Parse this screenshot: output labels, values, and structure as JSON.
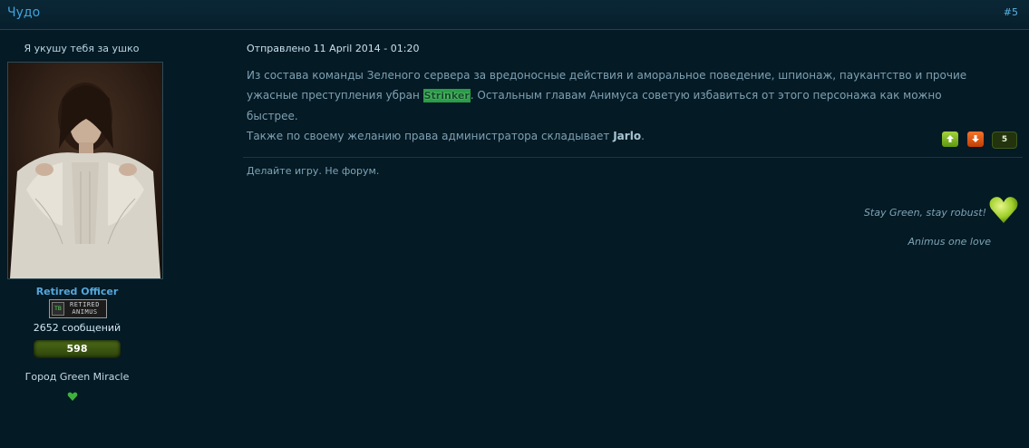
{
  "header": {
    "title": "Чудо",
    "post_number": "#5"
  },
  "author": {
    "nickname": "Я укушу тебя за ушко",
    "rank": "Retired Officer",
    "rank_badge_tag": "TB",
    "rank_badge_text": "RETIRED ANIMUS",
    "posts_count": "2652 сообщений",
    "reputation": "598",
    "city": "Город Green Miracle",
    "heart_icon": "heart-icon",
    "accent_color": "#56a7dc"
  },
  "post": {
    "date": "Отправлено 11 April 2014 - 01:20",
    "text_part1": "Из состава команды Зеленого сервера за вредоносные действия и аморальное поведение, шпионаж, паукантство и прочие ужасные преступления убран ",
    "highlighted_name": "Strinker",
    "text_part2": ". Остальным главам Анимуса советую избавиться от этого персонажа как можно быстрее.",
    "text_line3_prefix": "Также по своему желанию права администратора складывает ",
    "admin_name": "Jarlo",
    "text_line3_suffix": "."
  },
  "votes": {
    "up_icon": "arrow-up-icon",
    "down_icon": "arrow-down-icon",
    "count": "5"
  },
  "signature": {
    "line1": "Делайте игру. Не форум.",
    "line2": "Stay Green, stay robust!",
    "line3": "Animus one love"
  }
}
